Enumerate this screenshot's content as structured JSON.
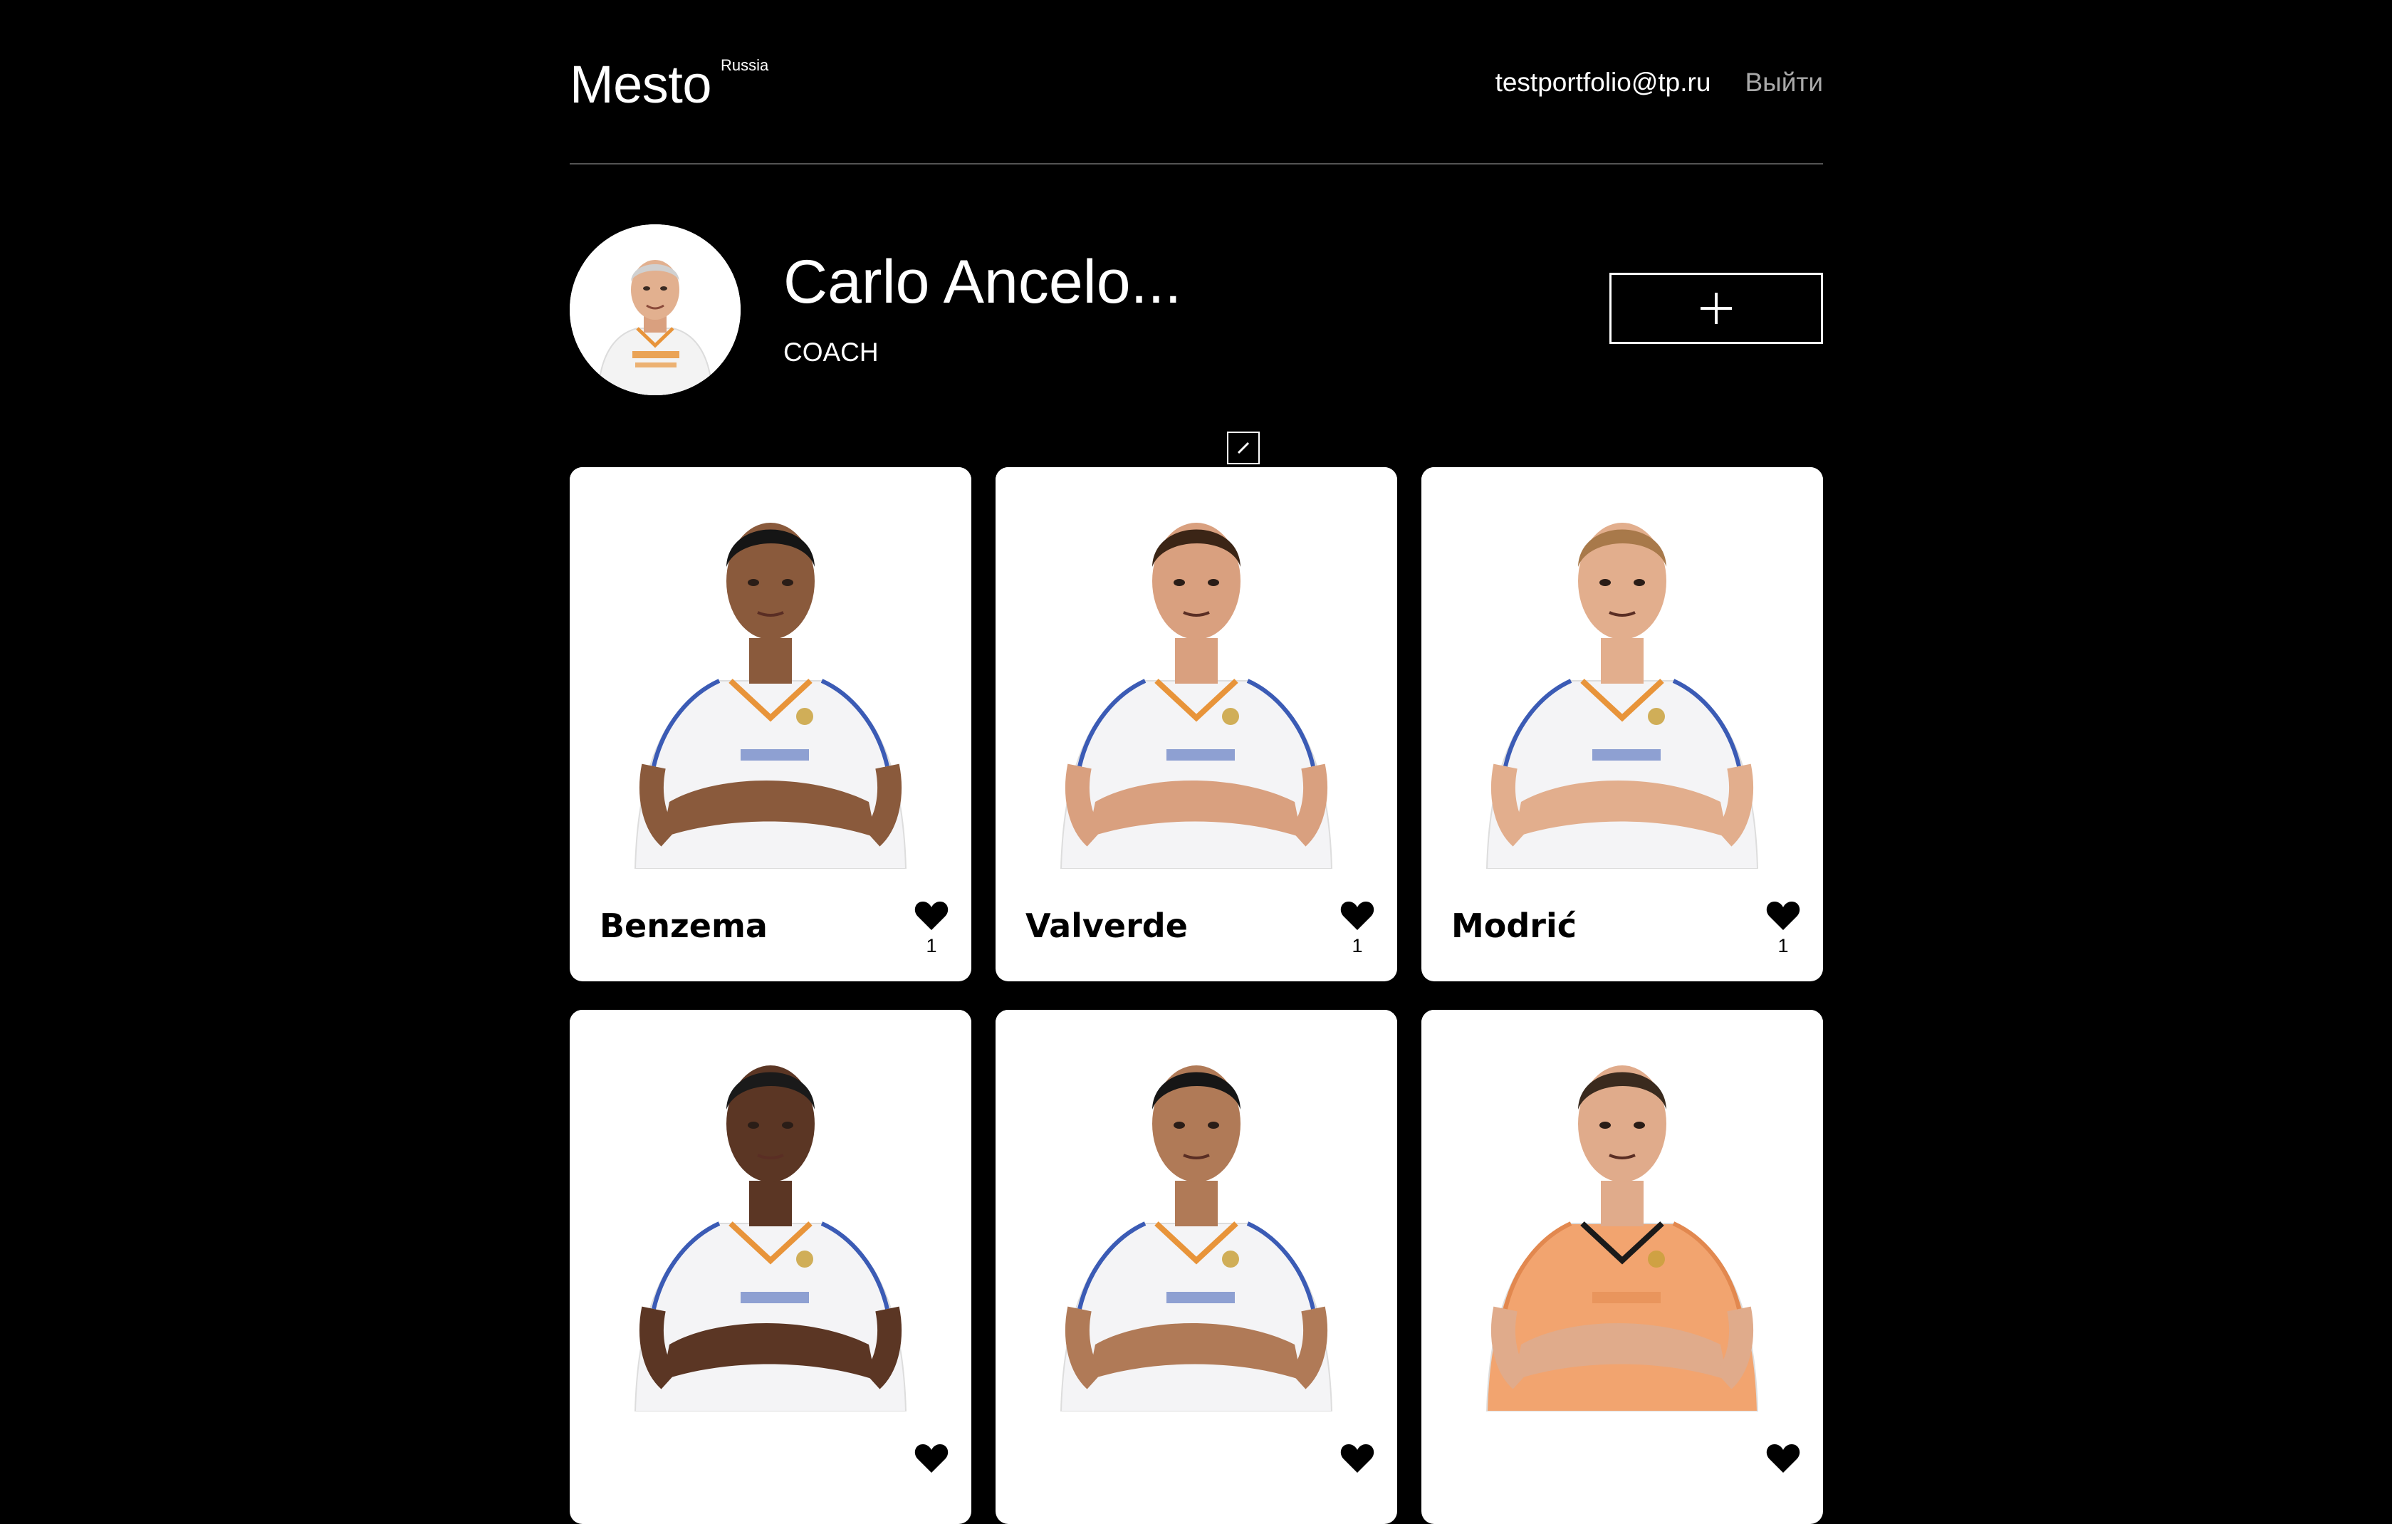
{
  "header": {
    "logo": "Mesto",
    "logo_superscript": "Russia",
    "email": "testportfolio@tp.ru",
    "logout_label": "Выйти"
  },
  "profile": {
    "name": "Carlo Ancelo...",
    "about": "COACH",
    "edit_icon": "pencil-icon",
    "add_icon": "plus-icon"
  },
  "cards": [
    {
      "title": "Benzema",
      "likes": "1",
      "kit": "white",
      "skin": "#8a5a3c",
      "hair": "#151515"
    },
    {
      "title": "Valverde",
      "likes": "1",
      "kit": "white",
      "skin": "#d9a07f",
      "hair": "#3b2516"
    },
    {
      "title": "Modrić",
      "likes": "1",
      "kit": "white",
      "skin": "#e2ae8d",
      "hair": "#a8794a"
    },
    {
      "title": "",
      "likes": "",
      "kit": "white",
      "skin": "#5b3624",
      "hair": "#1a1a1a"
    },
    {
      "title": "",
      "likes": "",
      "kit": "white",
      "skin": "#b07a57",
      "hair": "#161616"
    },
    {
      "title": "",
      "likes": "",
      "kit": "orange",
      "skin": "#e0ab8b",
      "hair": "#3a2a1e"
    }
  ],
  "colors": {
    "background": "#000000",
    "card": "#ffffff",
    "divider": "#545454",
    "muted": "#a9a9a9",
    "kit_orange": "#f2a46f",
    "kit_trim": "#e8943a",
    "kit_blue": "#3b5bb5"
  }
}
